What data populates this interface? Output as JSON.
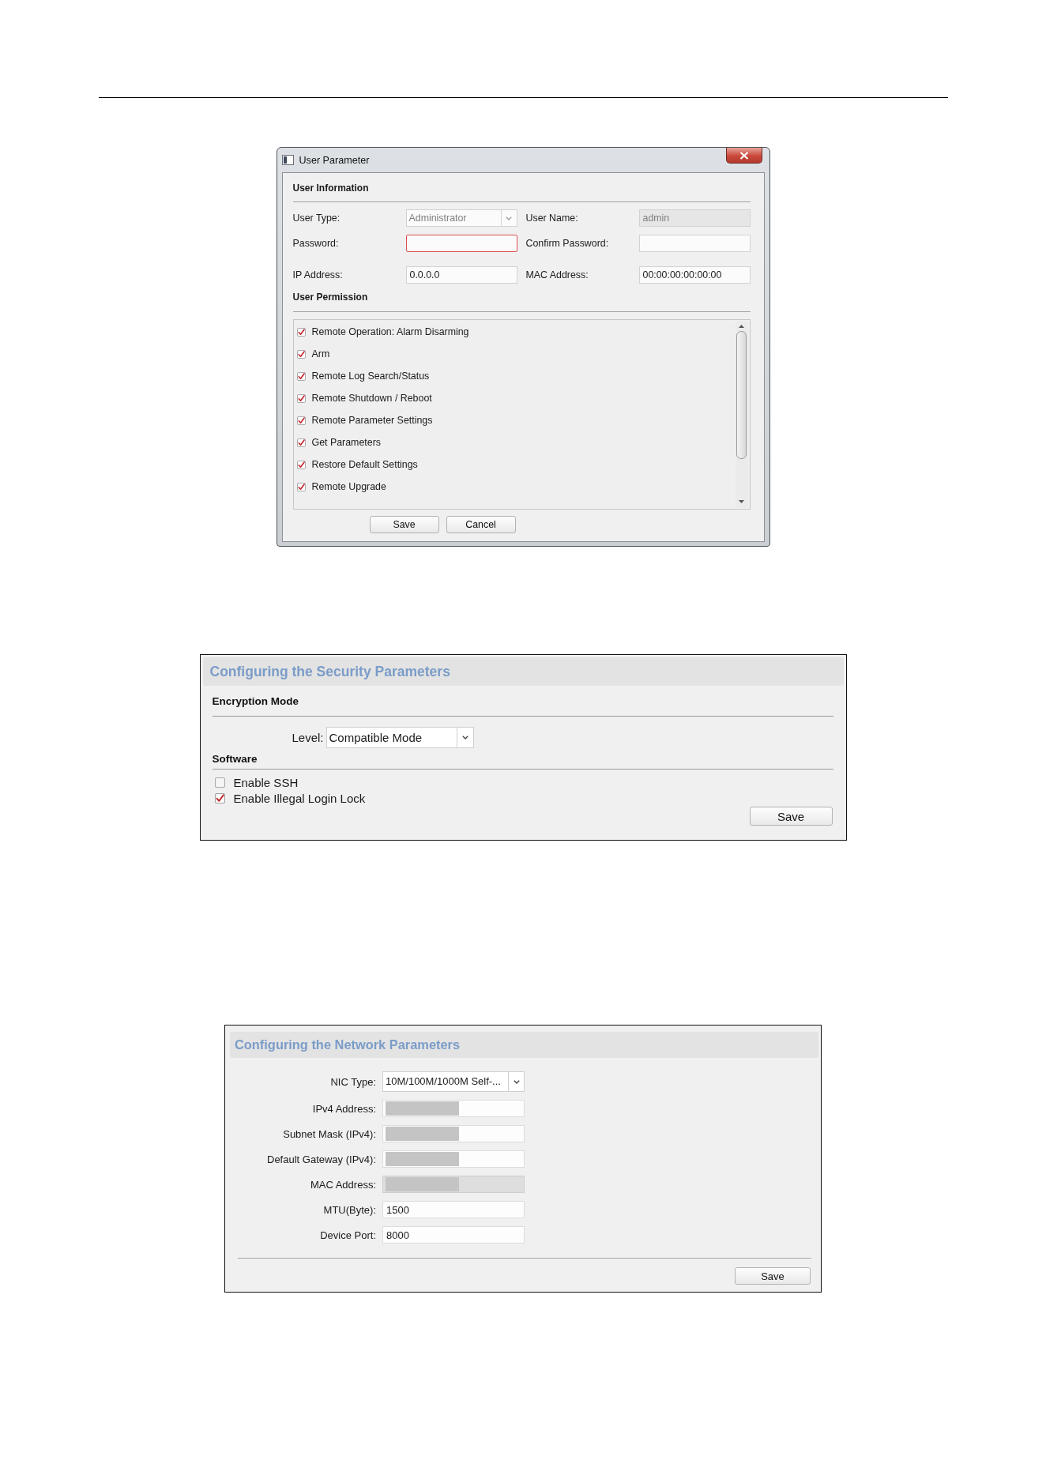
{
  "user_parameter_dialog": {
    "title": "User Parameter",
    "user_information": {
      "heading": "User Information",
      "fields": [
        {
          "label": "User Type:",
          "kind": "select",
          "value": "Administrator",
          "disabled": true,
          "error": false
        },
        {
          "label": "User Name:",
          "kind": "text",
          "value": "admin",
          "disabled": true,
          "error": false
        },
        {
          "label": "Password:",
          "kind": "text",
          "disabled": false,
          "error": true
        },
        {
          "label": "Confirm Password:",
          "kind": "text",
          "disabled": false,
          "error": false
        },
        {
          "label": "IP Address:",
          "kind": "text",
          "value": "0.0.0.0",
          "disabled": false,
          "error": false
        },
        {
          "label": "MAC Address:",
          "kind": "text",
          "value": "00:00:00:00:00:00",
          "disabled": false,
          "error": false
        }
      ]
    },
    "user_permission": {
      "heading": "User Permission",
      "permissions": [
        {
          "label": "Remote Operation: Alarm Disarming",
          "checked": true
        },
        {
          "label": "Arm",
          "checked": true
        },
        {
          "label": "Remote Log Search/Status",
          "checked": true
        },
        {
          "label": "Remote Shutdown / Reboot",
          "checked": true
        },
        {
          "label": "Remote Parameter Settings",
          "checked": true
        },
        {
          "label": "Get Parameters",
          "checked": true
        },
        {
          "label": "Restore Default Settings",
          "checked": true
        },
        {
          "label": "Remote Upgrade",
          "checked": true
        }
      ]
    },
    "buttons": [
      "Save",
      "Cancel"
    ]
  },
  "security_panel": {
    "title": "Configuring the Security Parameters",
    "encryption_mode": {
      "heading": "Encryption Mode",
      "mode_select": {
        "label": "Level:",
        "value": "Compatible Mode"
      }
    },
    "software": {
      "heading": "Software",
      "options": [
        {
          "label": "Enable SSH",
          "checked": false
        },
        {
          "label": "Enable Illegal Login Lock",
          "checked": true
        }
      ]
    },
    "save_button": "Save"
  },
  "network_panel": {
    "title": "Configuring the Network Parameters",
    "fields": [
      {
        "label": "NIC Type:",
        "kind": "select",
        "value": "10M/100M/1000M Self-...",
        "disabled": false,
        "redacted": false
      },
      {
        "label": "IPv4 Address:",
        "kind": "text",
        "disabled": false,
        "redacted": true
      },
      {
        "label": "Subnet Mask (IPv4):",
        "kind": "text",
        "disabled": false,
        "redacted": true
      },
      {
        "label": "Default Gateway (IPv4):",
        "kind": "text",
        "disabled": false,
        "redacted": true
      },
      {
        "label": "MAC Address:",
        "kind": "text",
        "disabled": true,
        "redacted": true
      },
      {
        "label": "MTU(Byte):",
        "kind": "text",
        "value": "1500",
        "disabled": false,
        "redacted": false
      },
      {
        "label": "Device Port:",
        "kind": "text",
        "value": "8000",
        "disabled": false,
        "redacted": false
      }
    ],
    "save_button": "Save"
  }
}
